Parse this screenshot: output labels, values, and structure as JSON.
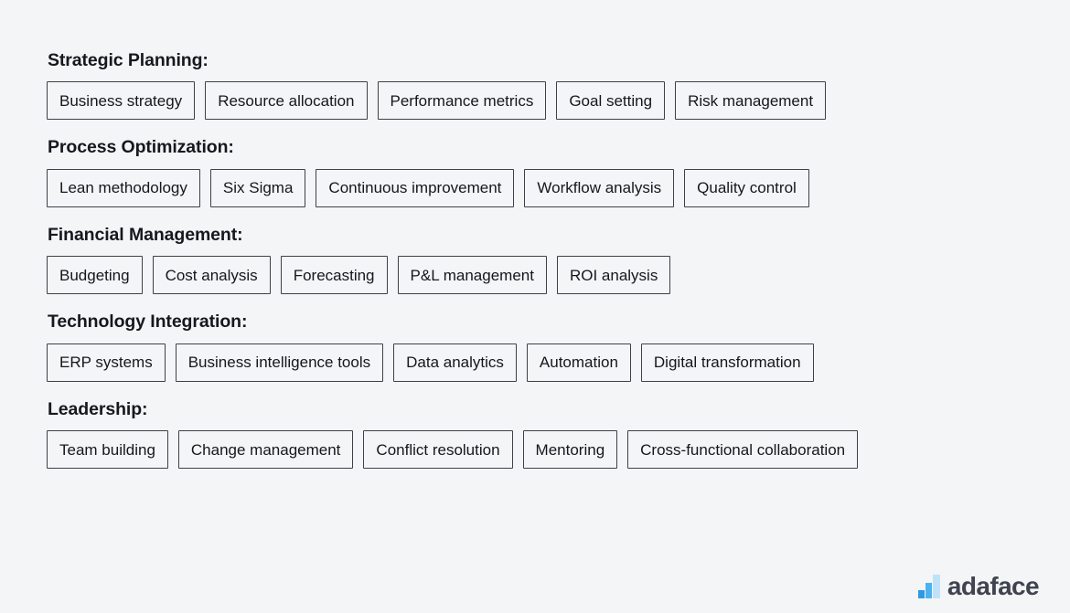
{
  "page": {
    "background_color": "#f4f5f7",
    "chip_border_color": "#3c4149",
    "text_color": "#15171c"
  },
  "sections": [
    {
      "heading": "Strategic Planning:",
      "chips": [
        "Business strategy",
        "Resource allocation",
        "Performance metrics",
        "Goal setting",
        "Risk management"
      ]
    },
    {
      "heading": "Process Optimization:",
      "chips": [
        "Lean methodology",
        "Six Sigma",
        "Continuous improvement",
        "Workflow analysis",
        "Quality control"
      ]
    },
    {
      "heading": "Financial Management:",
      "chips": [
        "Budgeting",
        "Cost analysis",
        "Forecasting",
        "P&L management",
        "ROI analysis"
      ]
    },
    {
      "heading": "Technology Integration:",
      "chips": [
        "ERP systems",
        "Business intelligence tools",
        "Data analytics",
        "Automation",
        "Digital transformation"
      ]
    },
    {
      "heading": "Leadership:",
      "chips": [
        "Team building",
        "Change management",
        "Conflict resolution",
        "Mentoring",
        "Cross-functional collaboration"
      ]
    }
  ],
  "brand": {
    "name": "adaface",
    "mark_icon": "bar-chart-icon",
    "mark_colors": [
      "#2f9ae0",
      "#4cb2ef",
      "#bfe2f8"
    ],
    "word_color": "#3f4450"
  }
}
